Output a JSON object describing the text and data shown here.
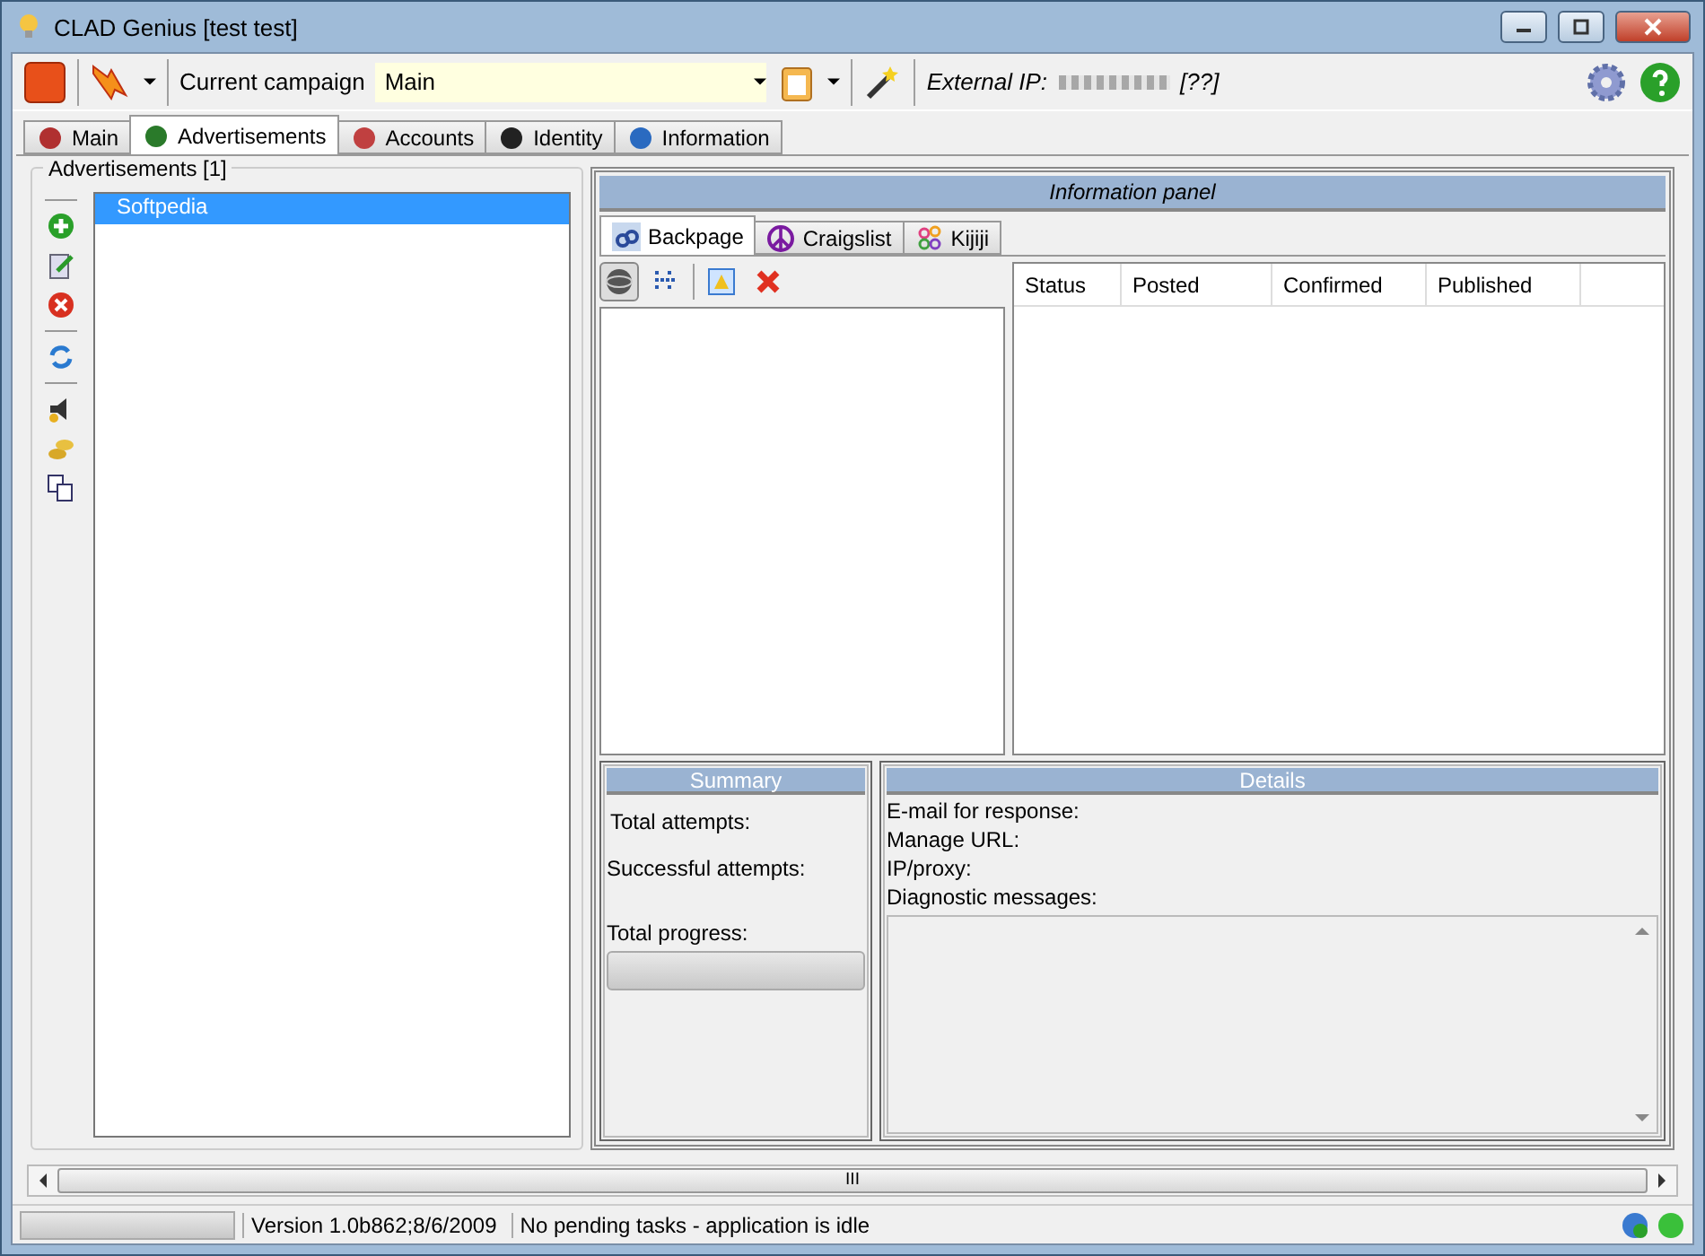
{
  "window": {
    "title": "CLAD Genius [test test]"
  },
  "toolbar": {
    "campaign_label": "Current campaign",
    "campaign_value": "Main",
    "external_ip_label": "External IP:",
    "external_ip_suffix": "[??]"
  },
  "tabs": [
    {
      "label": "Main",
      "selected": false
    },
    {
      "label": "Advertisements",
      "selected": true
    },
    {
      "label": "Accounts",
      "selected": false
    },
    {
      "label": "Identity",
      "selected": false
    },
    {
      "label": "Information",
      "selected": false
    }
  ],
  "advertisements": {
    "title": "Advertisements [1]",
    "items": [
      {
        "label": "Softpedia",
        "selected": true
      }
    ]
  },
  "information_panel": {
    "title": "Information panel",
    "site_tabs": [
      {
        "label": "Backpage",
        "selected": true
      },
      {
        "label": "Craigslist",
        "selected": false
      },
      {
        "label": "Kijiji",
        "selected": false
      }
    ],
    "table": {
      "columns": [
        "Status",
        "Posted",
        "Confirmed",
        "Published"
      ]
    },
    "summary": {
      "title": "Summary",
      "total_attempts": "Total attempts:",
      "successful_attempts": "Successful attempts:",
      "total_progress": "Total progress:",
      "level": 0
    },
    "details": {
      "title": "Details",
      "fields": [
        "E-mail for response:",
        "Manage URL:",
        "IP/proxy:",
        "Diagnostic messages:"
      ]
    }
  },
  "scrollbar": {
    "grip": "III"
  },
  "status_bar": {
    "level": 0,
    "version": "Version 1.0b862;8/6/2009",
    "message": "No pending tasks - application is idle"
  }
}
